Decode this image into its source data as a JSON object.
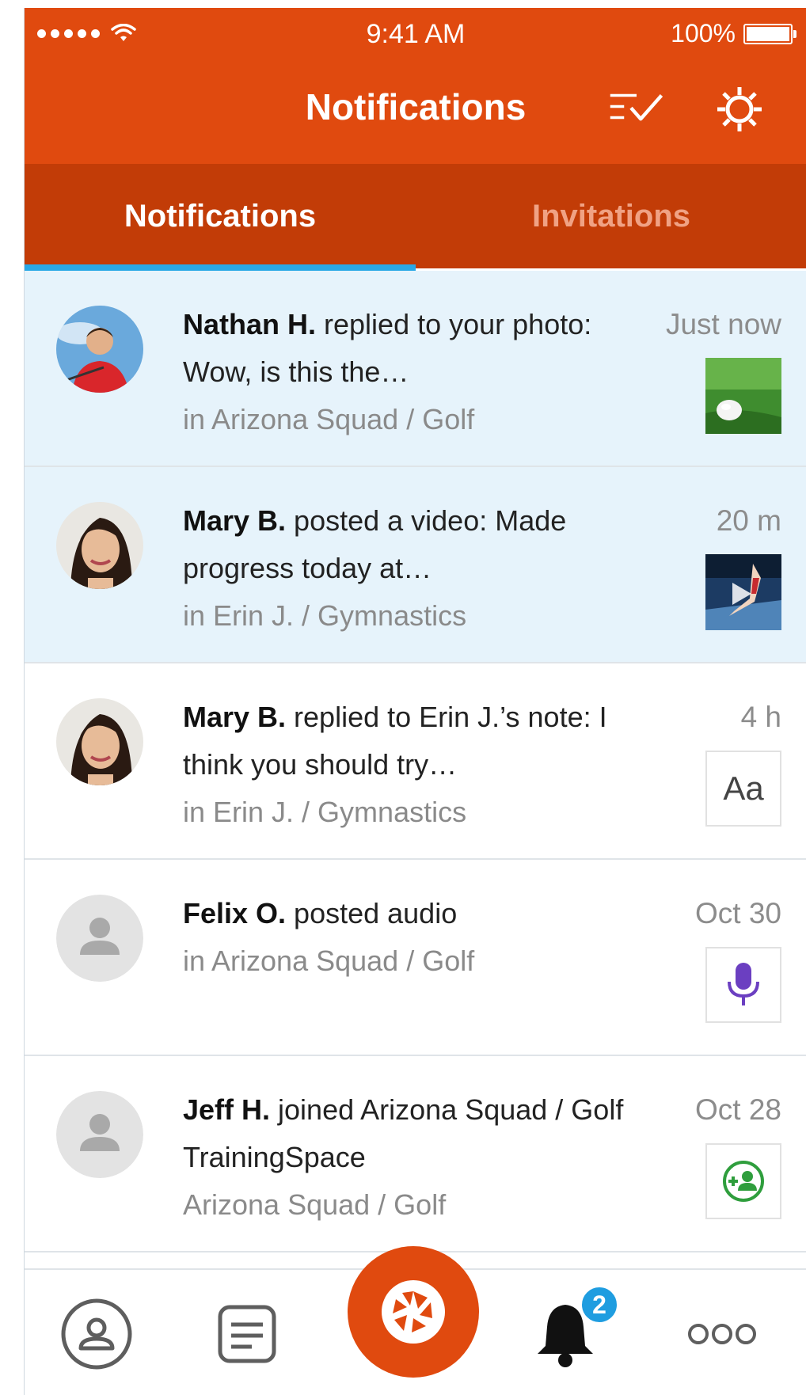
{
  "status_bar": {
    "time": "9:41 AM",
    "battery": "100%"
  },
  "header": {
    "title": "Notifications",
    "icons": [
      "mark-all-read-icon",
      "gear-icon"
    ]
  },
  "tabs": [
    {
      "label": "Notifications",
      "active": true
    },
    {
      "label": "Invitations",
      "active": false
    }
  ],
  "notifications": [
    {
      "name": "Nathan H.",
      "action": " replied to your photo: Wow, is this the…",
      "group": "in Arizona Squad / Golf",
      "time": "Just now",
      "thumbnail": "golf-ball-photo",
      "unread": true
    },
    {
      "name": "Mary B.",
      "action": " posted a video: Made progress today at…",
      "group": "in Erin J. / Gymnastics",
      "time": "20 m",
      "thumbnail": "gymnastics-video",
      "unread": true
    },
    {
      "name": "Mary B.",
      "action": " replied to Erin J.’s note: I think you should try…",
      "group": "in Erin J. / Gymnastics",
      "time": "4 h",
      "thumbnail": "text-note",
      "thumbnail_text": "Aa",
      "unread": false
    },
    {
      "name": "Felix O.",
      "action": " posted audio",
      "group": "in Arizona Squad / Golf",
      "time": "Oct 30",
      "thumbnail": "microphone-icon",
      "unread": false
    },
    {
      "name": "Jeff H.",
      "action": " joined Arizona Squad / Golf TrainingSpace",
      "group": "Arizona Squad / Golf",
      "time": "Oct 28",
      "thumbnail": "add-member-icon",
      "unread": false
    }
  ],
  "bottom_nav": {
    "items": [
      "profile-icon",
      "feed-icon",
      "camera-icon",
      "bell-icon",
      "more-icon"
    ],
    "bell_badge": "2"
  },
  "colors": {
    "header": "#e04a0f",
    "tabs_bar": "#c23c07",
    "tab_indicator": "#29a8e6",
    "unread_bg": "#e6f3fb",
    "badge": "#1f9de0"
  }
}
